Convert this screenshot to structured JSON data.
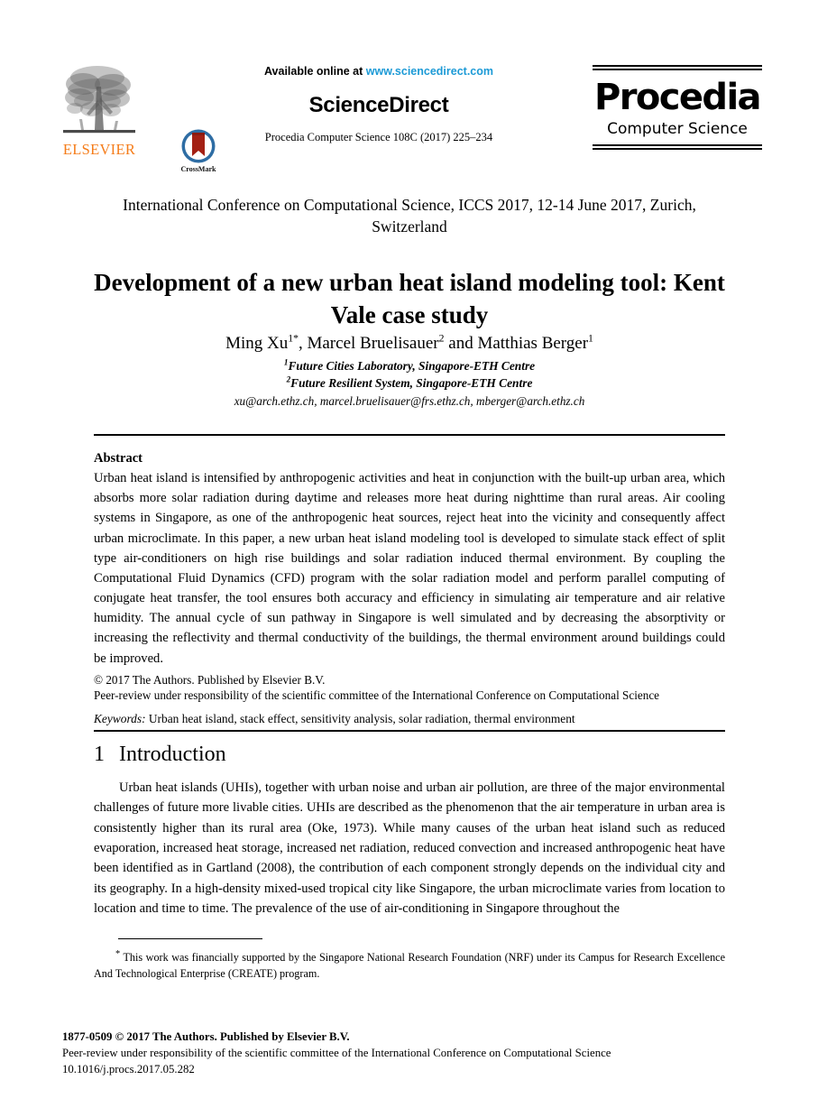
{
  "masthead": {
    "elsevier_wordmark": "ELSEVIER",
    "elsevier_color": "#F57C19",
    "crossmark_label": "CrossMark",
    "available_prefix": "Available online at ",
    "available_url": "www.sciencedirect.com",
    "url_color": "#1C9AD6",
    "sciencedirect_title": "ScienceDirect",
    "citation": "Procedia Computer Science 108C (2017) 225–234",
    "procedia_name": "Procedia",
    "procedia_subtitle": "Computer Science"
  },
  "conference": "International Conference on Computational Science, ICCS 2017, 12-14 June 2017, Zurich, Switzerland",
  "title": "Development of a new urban heat island modeling tool: Kent Vale case study",
  "authors": {
    "name_1": "Ming Xu",
    "sup_1": "1*",
    "sep_1": ", ",
    "name_2": "Marcel Bruelisauer",
    "sup_2": "2",
    "sep_2": " and ",
    "name_3": "Matthias Berger",
    "sup_3": "1"
  },
  "affiliations": [
    {
      "sup": "1",
      "text": "Future Cities Laboratory, Singapore-ETH Centre"
    },
    {
      "sup": "2",
      "text": "Future Resilient System, Singapore-ETH Centre"
    }
  ],
  "emails": "xu@arch.ethz.ch, marcel.bruelisauer@frs.ethz.ch, mberger@arch.ethz.ch",
  "abstract": {
    "heading": "Abstract",
    "body": "Urban heat island is intensified by anthropogenic activities and heat in conjunction with the built-up urban area, which absorbs more solar radiation during daytime and releases more heat during nighttime than rural areas. Air cooling systems in Singapore, as one of the anthropogenic heat sources, reject heat into the vicinity and consequently affect urban microclimate. In this paper, a new urban heat island modeling tool is developed to simulate stack effect of split type air-conditioners on high rise buildings and solar radiation induced thermal environment. By coupling the Computational Fluid Dynamics (CFD) program with the solar radiation model and perform parallel computing of conjugate heat transfer, the tool ensures both accuracy and efficiency in simulating air temperature and air relative humidity. The annual cycle of sun pathway in Singapore is well simulated and by decreasing the absorptivity or increasing the reflectivity and thermal conductivity of the buildings, the thermal environment around buildings could be improved."
  },
  "copyright": "© 2017 The Authors. Published by Elsevier B.V.",
  "peer_review": "Peer-review under responsibility of the scientific committee of the International Conference on Computational Science",
  "keywords": {
    "label": "Keywords:",
    "value": " Urban heat island, stack effect, sensitivity analysis, solar radiation, thermal environment"
  },
  "section": {
    "number": "1",
    "heading": "Introduction",
    "body": "Urban heat islands (UHIs), together with urban noise and urban air pollution, are three of the major environmental challenges of future more livable cities. UHIs are described as the phenomenon that the air temperature in urban area is consistently higher than its rural area (Oke, 1973). While many causes of the urban heat island such as reduced evaporation, increased heat storage, increased net radiation, reduced convection and increased anthropogenic heat have been identified as in Gartland (2008), the contribution of each component strongly depends on the individual city and its geography. In a high-density mixed-used tropical city like Singapore, the urban microclimate varies from location to location and time to time. The prevalence of the use of air-conditioning in Singapore throughout the"
  },
  "footnote": {
    "marker": "*",
    "text": " This work was financially supported by the Singapore National Research Foundation (NRF) under its Campus for Research Excellence And Technological Enterprise (CREATE) program."
  },
  "footer": {
    "issn_line": "1877-0509 © 2017 The Authors. Published by Elsevier B.V.",
    "peer_review_line": "Peer-review under responsibility of the scientific committee of the International Conference on Computational Science",
    "doi_line": "10.1016/j.procs.2017.05.282"
  }
}
